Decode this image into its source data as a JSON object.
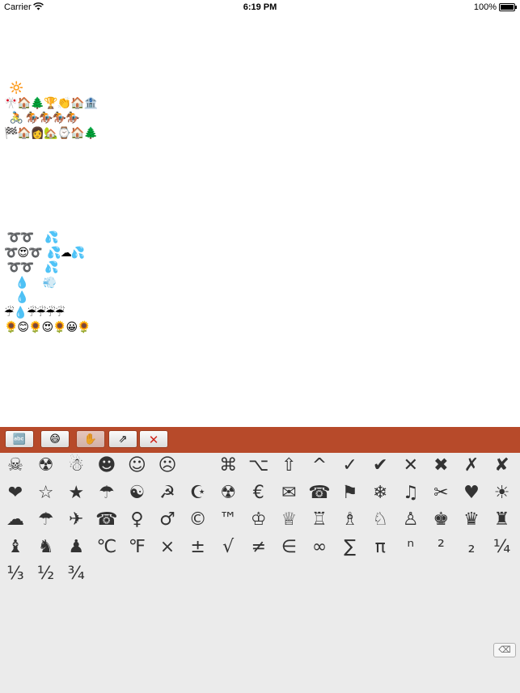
{
  "status_bar": {
    "carrier": "Carrier",
    "time": "6:19 PM",
    "battery": "100%",
    "battery_level": 1.0
  },
  "art": [
    "  🔆",
    "🎌🏠🌲🏆👏🏠🏦",
    "  🚴 🏇🏇🏇🏇",
    "🏁🏠👩🏡⌚🏠🌲",
    "",
    "",
    "",
    "",
    "",
    "",
    " ➰➰    💦",
    "➰😍➰  💦☁💦",
    " ➰➰    💦",
    "    💧     💨",
    "    💧",
    "☔💧☔☔☔☔",
    "🌻😊🌻😍🌻😀🌻"
  ],
  "toolbar": {
    "buttons": [
      {
        "name": "abc-keyboard-button",
        "label": "🔤",
        "disabled": false
      },
      {
        "name": "emoji-keyboard-button",
        "label": "😄",
        "disabled": false
      },
      {
        "name": "hand-button",
        "label": "✋",
        "disabled": true
      },
      {
        "name": "arrow-button",
        "label": "⇗",
        "disabled": false
      },
      {
        "name": "close-button",
        "label": "✕",
        "disabled": false
      }
    ]
  },
  "keyboard": {
    "rows": [
      [
        "☠",
        "☢",
        "☃",
        "☻",
        "☺",
        "☹",
        "",
        "⌘",
        "⌥",
        "⇧",
        "^",
        "✓",
        "✔",
        "✕",
        "✖",
        "✗",
        "✘"
      ],
      [
        "❤",
        "☆",
        "★",
        "☂",
        "☯",
        "☭",
        "☪",
        "☢",
        "€",
        "✉",
        "☎",
        "⚑",
        "❄",
        "♫",
        "✂",
        "♥",
        "☀"
      ],
      [
        "☁",
        "☂",
        "✈",
        "☎",
        "♀",
        "♂",
        "©",
        "™",
        "♔",
        "♕",
        "♖",
        "♗",
        "♘",
        "♙",
        "♚",
        "♛",
        "♜"
      ],
      [
        "♝",
        "♞",
        "♟",
        "℃",
        "℉",
        "×",
        "±",
        "√",
        "≠",
        "∈",
        "∞",
        "∑",
        "π",
        "ⁿ",
        "²",
        "₂",
        "¼"
      ],
      [
        "⅓",
        "½",
        "¾"
      ]
    ],
    "delete_label": "⌫"
  }
}
